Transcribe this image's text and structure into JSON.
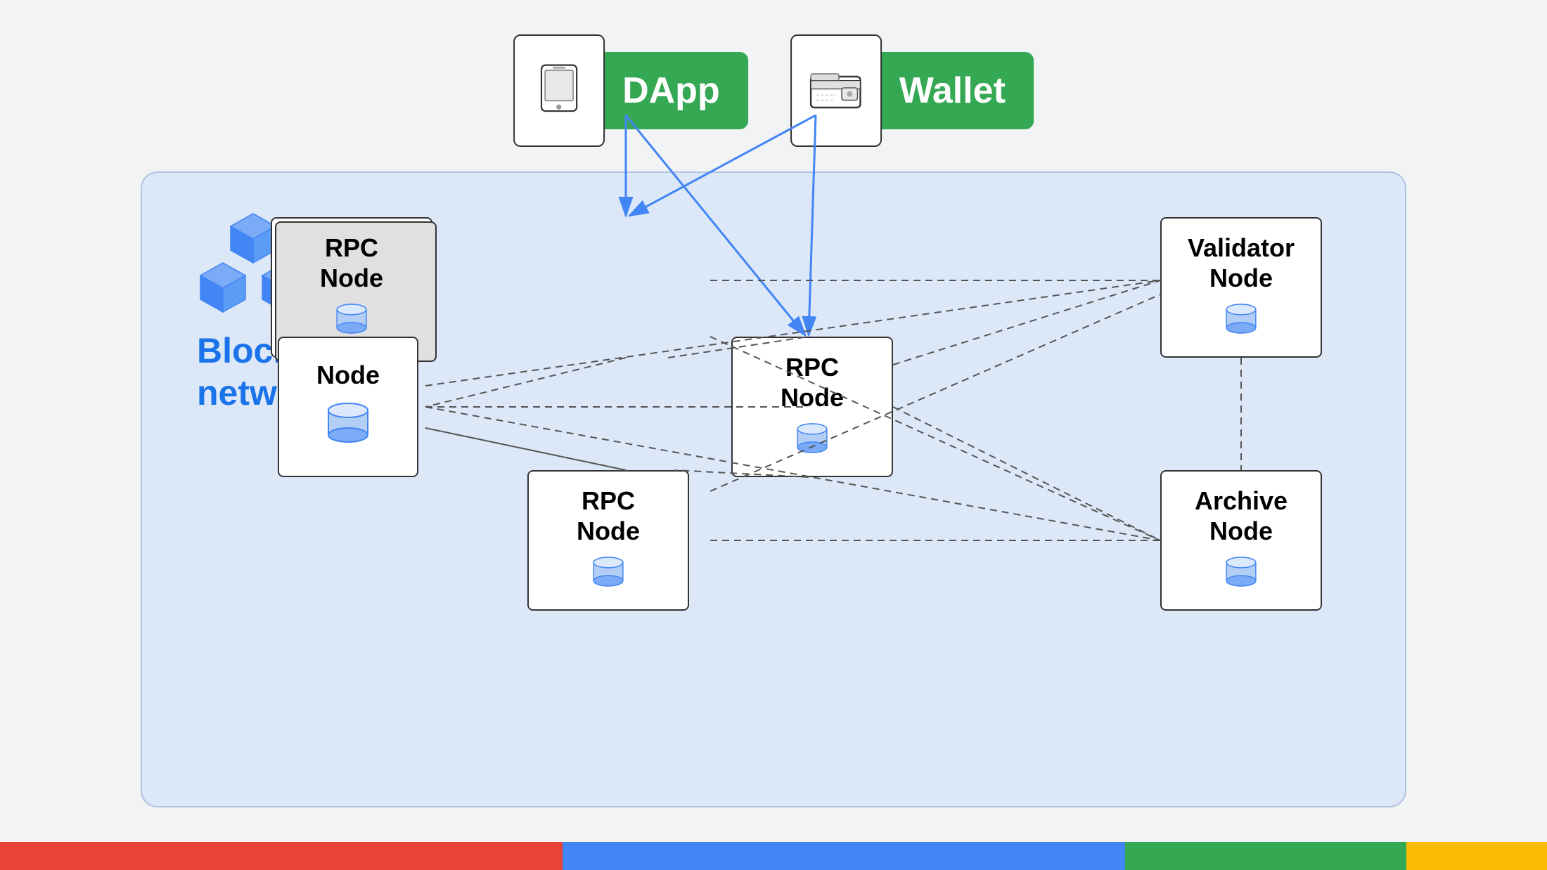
{
  "top": {
    "dapp": {
      "label": "DApp"
    },
    "wallet": {
      "label": "Wallet"
    }
  },
  "network": {
    "title_line1": "Blockchain",
    "title_line2": "network"
  },
  "nodes": {
    "rpc_top": {
      "title": "RPC\nNode"
    },
    "rpc_middle": {
      "title": "RPC\nNode"
    },
    "rpc_bottom": {
      "title": "RPC\nNode"
    },
    "node_plain": {
      "title": "Node"
    },
    "validator": {
      "title": "Validator\nNode"
    },
    "archive": {
      "title": "Archive\nNode"
    }
  },
  "colors": {
    "green": "#34a853",
    "blue": "#1a73e8",
    "red": "#ea4335",
    "yellow": "#fbbc04",
    "background": "#f1f3f4",
    "network_bg": "#dce8f8"
  },
  "bottom_bar": [
    {
      "color": "#ea4335",
      "flex": 2
    },
    {
      "color": "#4285f4",
      "flex": 2
    },
    {
      "color": "#34a853",
      "flex": 1
    },
    {
      "color": "#fbbc04",
      "flex": 0.5
    }
  ]
}
